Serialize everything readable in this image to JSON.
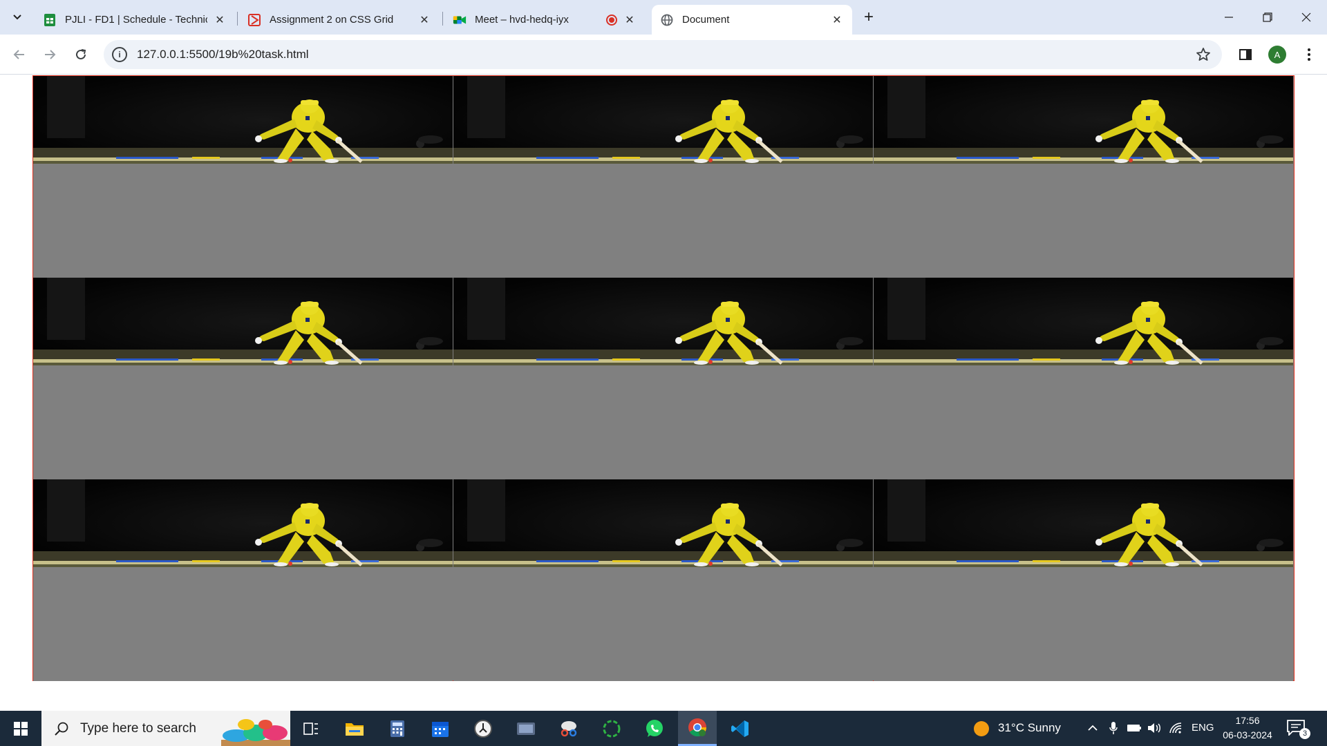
{
  "browser": {
    "tabs": [
      {
        "title": "PJLI - FD1 | Schedule - Technical",
        "favicon": "google-sheets-icon",
        "color": "#1e8e3e"
      },
      {
        "title": "Assignment 2 on CSS Grid",
        "favicon": "classroom-icon",
        "color": "#d93025"
      },
      {
        "title": "Meet – hvd-hedq-iyx",
        "favicon": "google-meet-icon",
        "color": "#00832d"
      },
      {
        "title": "Document",
        "favicon": "globe-icon",
        "color": "#5f6368"
      }
    ],
    "url": "127.0.0.1:5500/19b%20task.html",
    "profile_initial": "A"
  },
  "page": {
    "grid": {
      "rows": 3,
      "columns": 3,
      "cell_background": "#808080",
      "border_color": "#e0301e"
    },
    "image_description_icon": "cricket-player-photo"
  },
  "taskbar": {
    "search_placeholder": "Type here to search",
    "weather": "31°C  Sunny",
    "language": "ENG",
    "time": "17:56",
    "date": "06-03-2024",
    "notification_count": "3"
  }
}
